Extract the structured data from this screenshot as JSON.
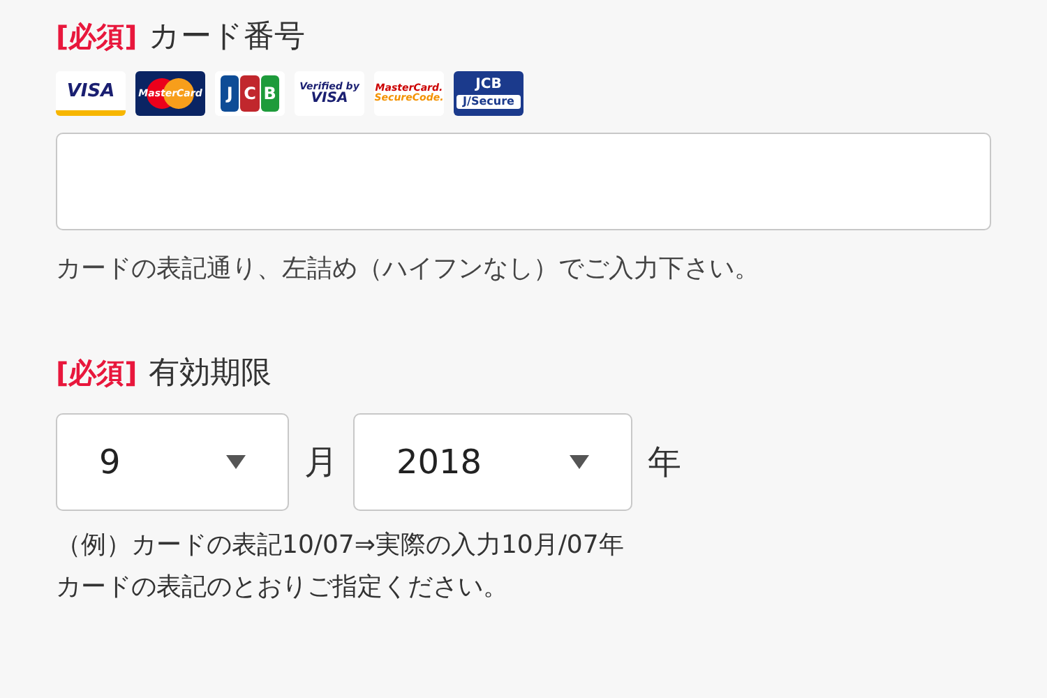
{
  "card_number": {
    "required": "[必須]",
    "label": "カード番号",
    "logos": [
      {
        "kind": "visa",
        "lines": [
          "VISA"
        ]
      },
      {
        "kind": "mastercard",
        "lines": [
          "MasterCard"
        ]
      },
      {
        "kind": "jcb",
        "lines": [
          "J",
          "C",
          "B"
        ]
      },
      {
        "kind": "verified",
        "lines": [
          "Verified by",
          "VISA"
        ]
      },
      {
        "kind": "securecode",
        "lines": [
          "MasterCard.",
          "SecureCode."
        ]
      },
      {
        "kind": "jsecure",
        "lines": [
          "JCB",
          "J/Secure"
        ]
      }
    ],
    "hint": "カードの表記通り、左詰め（ハイフンなし）でご入力下さい。"
  },
  "expiry": {
    "required": "[必須]",
    "label": "有効期限",
    "month": {
      "value": "9",
      "unit": "月"
    },
    "year": {
      "value": "2018",
      "unit": "年"
    },
    "notes": [
      "（例）カードの表記10/07⇒実際の入力10月/07年",
      "カードの表記のとおりご指定ください。"
    ]
  }
}
